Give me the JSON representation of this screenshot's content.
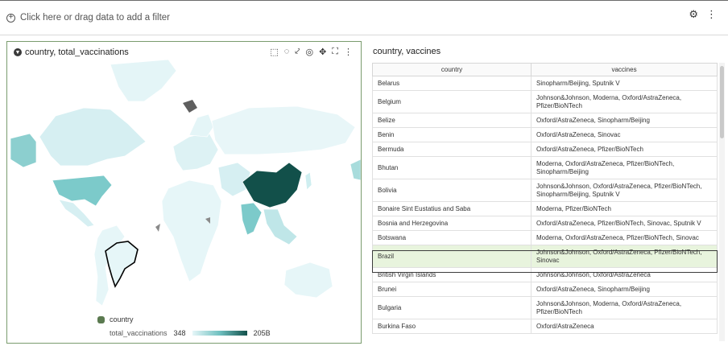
{
  "filter_bar": {
    "placeholder": "Click here or drag data to add a filter",
    "icons": [
      "plus-circle-icon",
      "settings-icon",
      "more-icon"
    ]
  },
  "map_panel": {
    "title": "country, total_vaccinations",
    "tools": [
      "select-icon",
      "lasso-icon",
      "zoom-icon",
      "target-icon",
      "pan-icon",
      "fullscreen-icon",
      "more-icon"
    ],
    "legend": {
      "series_label": "country",
      "metric_label": "total_vaccinations",
      "min_label": "348",
      "max_label": "205B"
    },
    "colors": {
      "low": "#e6f6f8",
      "mid": "#a8dcdc",
      "high": "#12504a",
      "outline": "#000000"
    }
  },
  "table_panel": {
    "title": "country, vaccines",
    "columns": [
      "country",
      "vaccines"
    ],
    "rows": [
      [
        "Belarus",
        "Sinopharm/Beijing, Sputnik V"
      ],
      [
        "Belgium",
        "Johnson&Johnson, Moderna, Oxford/AstraZeneca, Pfizer/BioNTech"
      ],
      [
        "Belize",
        "Oxford/AstraZeneca, Sinopharm/Beijing"
      ],
      [
        "Benin",
        "Oxford/AstraZeneca, Sinovac"
      ],
      [
        "Bermuda",
        "Oxford/AstraZeneca, Pfizer/BioNTech"
      ],
      [
        "Bhutan",
        "Moderna, Oxford/AstraZeneca, Pfizer/BioNTech, Sinopharm/Beijing"
      ],
      [
        "Bolivia",
        "Johnson&Johnson, Oxford/AstraZeneca, Pfizer/BioNTech, Sinopharm/Beijing, Sputnik V"
      ],
      [
        "Bonaire Sint Eustatius and Saba",
        "Moderna, Pfizer/BioNTech"
      ],
      [
        "Bosnia and Herzegovina",
        "Oxford/AstraZeneca, Pfizer/BioNTech, Sinovac, Sputnik V"
      ],
      [
        "Botswana",
        "Moderna, Oxford/AstraZeneca, Pfizer/BioNTech, Sinovac"
      ],
      [
        "Brazil",
        "Johnson&Johnson, Oxford/AstraZeneca, Pfizer/BioNTech, Sinovac"
      ],
      [
        "British Virgin Islands",
        "Johnson&Johnson, Oxford/AstraZeneca"
      ],
      [
        "Brunei",
        "Oxford/AstraZeneca, Sinopharm/Beijing"
      ],
      [
        "Bulgaria",
        "Johnson&Johnson, Moderna, Oxford/AstraZeneca, Pfizer/BioNTech"
      ],
      [
        "Burkina Faso",
        "Oxford/AstraZeneca"
      ]
    ],
    "selected_row": "Brazil"
  }
}
